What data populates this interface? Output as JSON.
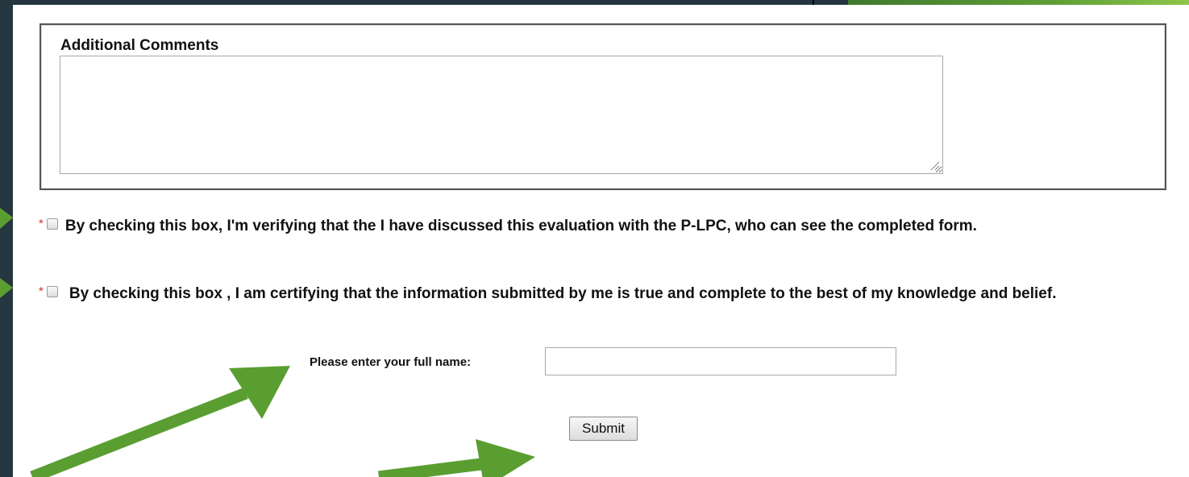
{
  "comments": {
    "title": "Additional Comments",
    "value": ""
  },
  "certifications": [
    {
      "required_mark": "*",
      "text": "By checking this box, I'm verifying that the I have discussed this evaluation with the P-LPC, who can see the completed form.",
      "checked": false
    },
    {
      "required_mark": "*",
      "text": "By checking this box , I am certifying that the information submitted by me is true and complete to the best of my knowledge and belief.",
      "checked": false
    }
  ],
  "full_name": {
    "label": "Please enter your full name:",
    "value": ""
  },
  "submit": {
    "label": "Submit"
  },
  "colors": {
    "frame": "#243640",
    "annotation_arrow": "#5a9e32",
    "required_star": "#d32f2f"
  },
  "icons": {
    "textarea_resize": "resize-grip-icon",
    "annotation": "arrow-icon"
  }
}
